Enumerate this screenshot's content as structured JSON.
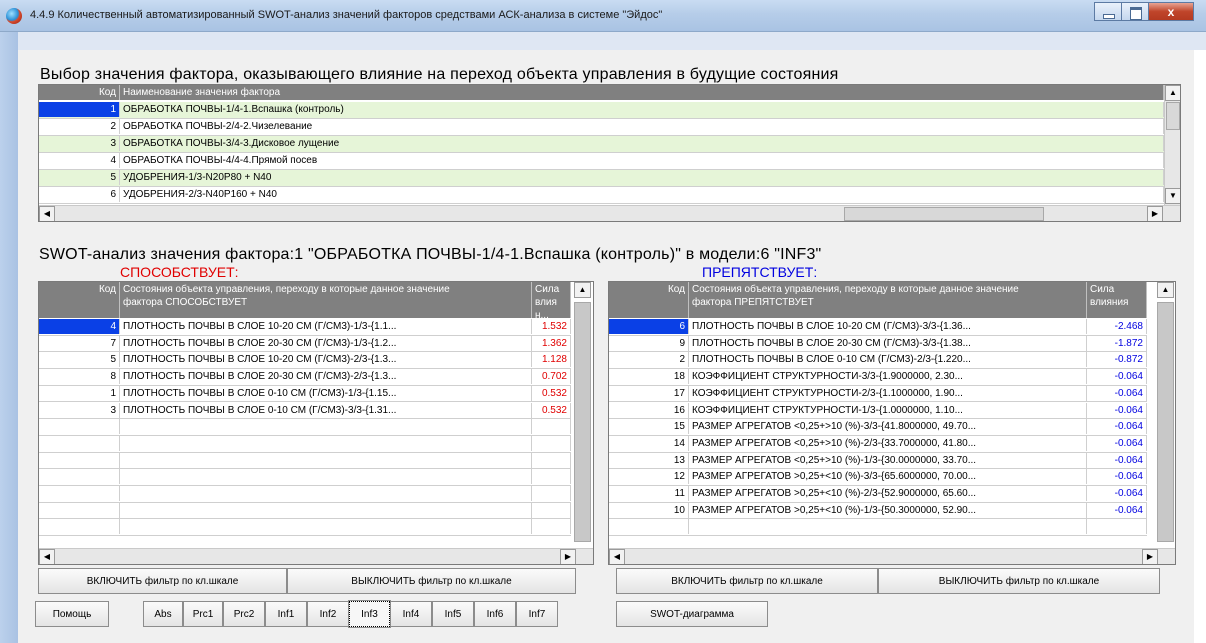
{
  "window": {
    "title": "4.4.9 Количественный автоматизированный SWOT-анализ значений факторов средствами АСК-анализа в системе \"Эйдос\"",
    "close_glyph": "x",
    "icons": [
      "app-icon",
      "minimize-icon",
      "maximize-icon",
      "close-icon"
    ]
  },
  "factor_section": {
    "heading": "Выбор значения фактора, оказывающего влияние на переход объекта управления в будущие состояния",
    "columns": [
      "Код",
      "Наименование значения фактора"
    ],
    "rows": [
      {
        "code": "1",
        "name": "ОБРАБОТКА ПОЧВЫ-1/4-1.Вспашка (контроль)"
      },
      {
        "code": "2",
        "name": "ОБРАБОТКА ПОЧВЫ-2/4-2.Чизелевание"
      },
      {
        "code": "3",
        "name": "ОБРАБОТКА ПОЧВЫ-3/4-3.Дисковое лущение"
      },
      {
        "code": "4",
        "name": "ОБРАБОТКА ПОЧВЫ-4/4-4.Прямой посев"
      },
      {
        "code": "5",
        "name": "УДОБРЕНИЯ-1/3-N20P80 + N40"
      },
      {
        "code": "6",
        "name": "УДОБРЕНИЯ-2/3-N40P160 + N40"
      }
    ]
  },
  "swot": {
    "heading": "SWOT-анализ значения фактора:1 \"ОБРАБОТКА ПОЧВЫ-1/4-1.Вспашка (контроль)\" в модели:6 \"INF3\"",
    "promotes_label": "СПОСОБСТВУЕТ:",
    "hinders_label": "ПРЕПЯТСТВУЕТ:",
    "colors": {
      "promotes": "#e00000",
      "hinders": "#0000e0",
      "selected": "#0a40e6"
    },
    "left": {
      "columns": [
        "Код",
        "Состояния объекта управления, переходу в которые данное значение фактора СПОСОБСТВУЕТ",
        "Сила влиян..."
      ],
      "rows": [
        {
          "code": "4",
          "name": "ПЛОТНОСТЬ ПОЧВЫ В СЛОЕ 10-20 СМ (Г/СМ3)-1/3-{1.1...",
          "value": "1.532"
        },
        {
          "code": "7",
          "name": "ПЛОТНОСТЬ ПОЧВЫ В СЛОЕ 20-30 СМ (Г/СМ3)-1/3-{1.2...",
          "value": "1.362"
        },
        {
          "code": "5",
          "name": "ПЛОТНОСТЬ ПОЧВЫ В СЛОЕ 10-20 СМ (Г/СМ3)-2/3-{1.3...",
          "value": "1.128"
        },
        {
          "code": "8",
          "name": "ПЛОТНОСТЬ ПОЧВЫ В СЛОЕ 20-30 СМ (Г/СМ3)-2/3-{1.3...",
          "value": "0.702"
        },
        {
          "code": "1",
          "name": "ПЛОТНОСТЬ ПОЧВЫ В СЛОЕ 0-10 СМ (Г/СМ3)-1/3-{1.15...",
          "value": "0.532"
        },
        {
          "code": "3",
          "name": "ПЛОТНОСТЬ ПОЧВЫ В СЛОЕ 0-10 СМ (Г/СМ3)-3/3-{1.31...",
          "value": "0.532"
        }
      ]
    },
    "right": {
      "columns": [
        "Код",
        "Состояния объекта управления, переходу в которые данное значение фактора ПРЕПЯТСТВУЕТ",
        "Сила влияния"
      ],
      "rows": [
        {
          "code": "6",
          "name": "ПЛОТНОСТЬ ПОЧВЫ В СЛОЕ 10-20 СМ (Г/СМ3)-3/3-{1.36...",
          "value": "-2.468"
        },
        {
          "code": "9",
          "name": "ПЛОТНОСТЬ ПОЧВЫ В СЛОЕ 20-30 СМ (Г/СМ3)-3/3-{1.38...",
          "value": "-1.872"
        },
        {
          "code": "2",
          "name": "ПЛОТНОСТЬ ПОЧВЫ В СЛОЕ 0-10 СМ (Г/СМ3)-2/3-{1.220...",
          "value": "-0.872"
        },
        {
          "code": "18",
          "name": "КОЭФФИЦИЕНТ СТРУКТУРНОСТИ-3/3-{1.9000000, 2.30...",
          "value": "-0.064"
        },
        {
          "code": "17",
          "name": "КОЭФФИЦИЕНТ СТРУКТУРНОСТИ-2/3-{1.1000000, 1.90...",
          "value": "-0.064"
        },
        {
          "code": "16",
          "name": "КОЭФФИЦИЕНТ СТРУКТУРНОСТИ-1/3-{1.0000000, 1.10...",
          "value": "-0.064"
        },
        {
          "code": "15",
          "name": "РАЗМЕР АГРЕГАТОВ <0,25+>10 (%)-3/3-{41.8000000, 49.70...",
          "value": "-0.064"
        },
        {
          "code": "14",
          "name": "РАЗМЕР АГРЕГАТОВ <0,25+>10 (%)-2/3-{33.7000000, 41.80...",
          "value": "-0.064"
        },
        {
          "code": "13",
          "name": "РАЗМЕР АГРЕГАТОВ <0,25+>10 (%)-1/3-{30.0000000, 33.70...",
          "value": "-0.064"
        },
        {
          "code": "12",
          "name": "РАЗМЕР АГРЕГАТОВ >0,25+<10 (%)-3/3-{65.6000000, 70.00...",
          "value": "-0.064"
        },
        {
          "code": "11",
          "name": "РАЗМЕР АГРЕГАТОВ >0,25+<10 (%)-2/3-{52.9000000, 65.60...",
          "value": "-0.064"
        },
        {
          "code": "10",
          "name": "РАЗМЕР АГРЕГАТОВ >0,25+<10 (%)-1/3-{50.3000000, 52.90...",
          "value": "-0.064"
        }
      ]
    }
  },
  "buttons": {
    "filter_on_left": "ВКЛЮЧИТЬ фильтр по кл.шкале",
    "filter_off_left": "ВЫКЛЮЧИТЬ фильтр по кл.шкале",
    "filter_on_right": "ВКЛЮЧИТЬ фильтр по кл.шкале",
    "filter_off_right": "ВЫКЛЮЧИТЬ фильтр по кл.шкале",
    "help": "Помощь",
    "swot_diagram": "SWOT-диаграмма",
    "models": [
      "Abs",
      "Prc1",
      "Prc2",
      "Inf1",
      "Inf2",
      "Inf3",
      "Inf4",
      "Inf5",
      "Inf6",
      "Inf7"
    ],
    "selected_model": "Inf3"
  }
}
